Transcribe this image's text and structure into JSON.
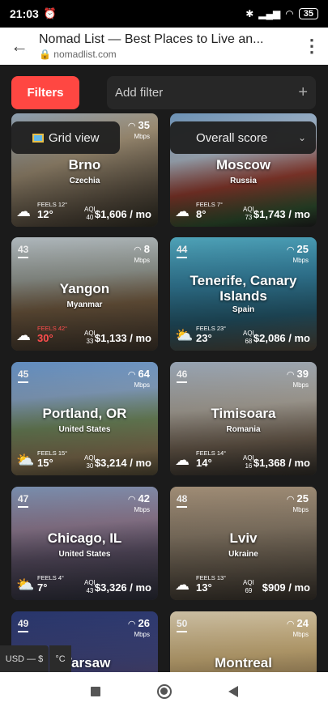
{
  "status_bar": {
    "time": "21:03",
    "battery": "35"
  },
  "browser": {
    "title": "Nomad List — Best Places to Live an...",
    "domain": "nomadlist.com"
  },
  "toolbar": {
    "filters_label": "Filters",
    "add_filter_label": "Add filter",
    "grid_view_label": "Grid view",
    "sort_label": "Overall score"
  },
  "cards": [
    {
      "rank": "",
      "city": "Brno",
      "country": "Czechia",
      "internet": "35",
      "internet_unit": "Mbps",
      "feels": "FEELS 12°",
      "temp": "12°",
      "aqi": "40",
      "cost": "$1,606 / mo"
    },
    {
      "rank": "",
      "city": "Moscow",
      "country": "Russia",
      "internet": "",
      "internet_unit": "",
      "feels": "FEELS 7°",
      "temp": "8°",
      "aqi": "73",
      "cost": "$1,743 / mo"
    },
    {
      "rank": "43",
      "city": "Yangon",
      "country": "Myanmar",
      "internet": "8",
      "internet_unit": "Mbps",
      "feels": "FEELS 42°",
      "temp": "30°",
      "aqi": "33",
      "cost": "$1,133 / mo"
    },
    {
      "rank": "44",
      "city": "Tenerife, Canary Islands",
      "country": "Spain",
      "internet": "25",
      "internet_unit": "Mbps",
      "feels": "FEELS 23°",
      "temp": "23°",
      "aqi": "68",
      "cost": "$2,086 / mo"
    },
    {
      "rank": "45",
      "city": "Portland, OR",
      "country": "United States",
      "internet": "64",
      "internet_unit": "Mbps",
      "feels": "FEELS 15°",
      "temp": "15°",
      "aqi": "30",
      "cost": "$3,214 / mo"
    },
    {
      "rank": "46",
      "city": "Timisoara",
      "country": "Romania",
      "internet": "39",
      "internet_unit": "Mbps",
      "feels": "FEELS 14°",
      "temp": "14°",
      "aqi": "16",
      "cost": "$1,368 / mo"
    },
    {
      "rank": "47",
      "city": "Chicago, IL",
      "country": "United States",
      "internet": "42",
      "internet_unit": "Mbps",
      "feels": "FEELS 4°",
      "temp": "7°",
      "aqi": "43",
      "cost": "$3,326 / mo"
    },
    {
      "rank": "48",
      "city": "Lviv",
      "country": "Ukraine",
      "internet": "25",
      "internet_unit": "Mbps",
      "feels": "FEELS 13°",
      "temp": "13°",
      "aqi": "69",
      "cost": "$909 / mo"
    },
    {
      "rank": "49",
      "city": "Warsaw",
      "country": "",
      "internet": "26",
      "internet_unit": "Mbps",
      "feels": "",
      "temp": "",
      "aqi": "",
      "cost": ""
    },
    {
      "rank": "50",
      "city": "Montreal",
      "country": "",
      "internet": "24",
      "internet_unit": "Mbps",
      "feels": "",
      "temp": "",
      "aqi": "",
      "cost": ""
    }
  ],
  "labels": {
    "aqi": "AQI"
  },
  "footer": {
    "currency": "USD — $",
    "units": "°C"
  },
  "colors": {
    "accent": "#ff4742",
    "hot_temp": "#ff4d4d"
  }
}
